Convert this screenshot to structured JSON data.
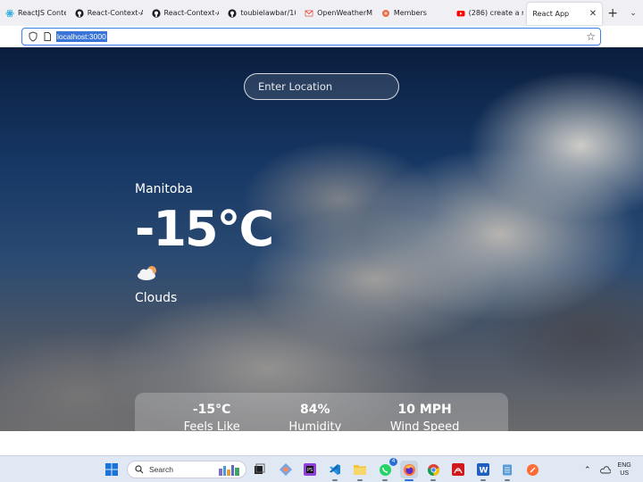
{
  "browser": {
    "tabs": [
      {
        "label": "ReactJS Context A",
        "icon": "react-icon",
        "active": false
      },
      {
        "label": "React-Context-AP",
        "icon": "github-icon",
        "active": false
      },
      {
        "label": "React-Context-AP",
        "icon": "github-icon",
        "active": false
      },
      {
        "label": "toubielawbar/101",
        "icon": "github-icon",
        "active": false
      },
      {
        "label": "OpenWeatherMa",
        "icon": "gmail-icon",
        "active": false
      },
      {
        "label": "Members",
        "icon": "figma-icon",
        "active": false
      },
      {
        "label": "(286) create a rea",
        "icon": "youtube-icon",
        "active": false
      },
      {
        "label": "React App",
        "icon": "none",
        "active": true
      }
    ],
    "new_tab_label": "+",
    "url": "localhost:3000"
  },
  "app": {
    "search_placeholder": "Enter Location",
    "location": "Manitoba",
    "temperature": "-15°C",
    "condition_icon": "cloud-sun-icon",
    "condition": "Clouds",
    "stats": [
      {
        "value": "-15°C",
        "label": "Feels Like"
      },
      {
        "value": "84%",
        "label": "Humidity"
      },
      {
        "value": "10 MPH",
        "label": "Wind Speed"
      }
    ]
  },
  "taskbar": {
    "search_label": "Search",
    "whatsapp_badge": "4",
    "language_line1": "ENG",
    "language_line2": "US"
  },
  "colors": {
    "accent": "#3d7eea",
    "url_highlight": "#3875d7",
    "taskbar": "#dfe8f3"
  }
}
